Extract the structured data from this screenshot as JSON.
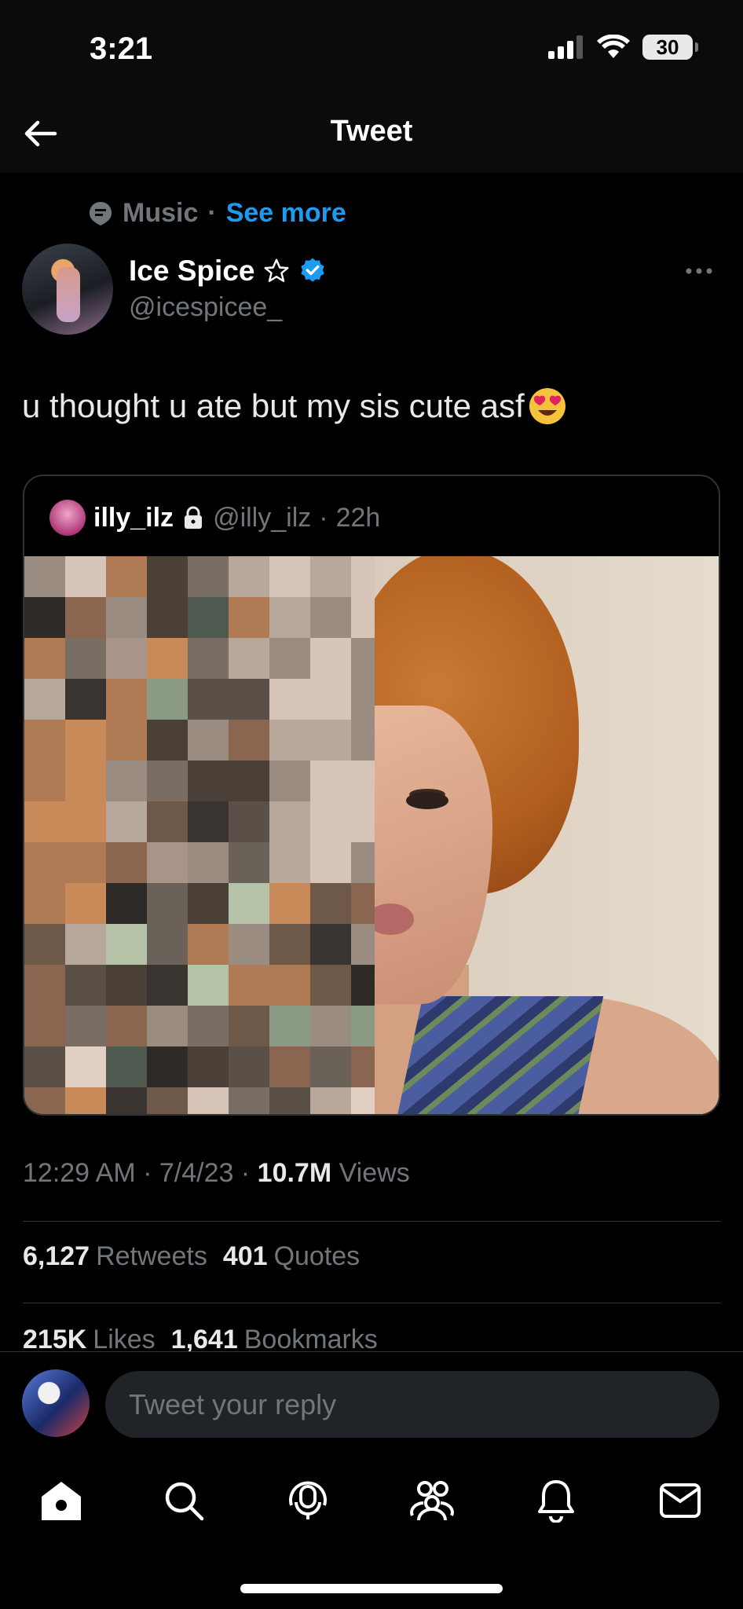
{
  "status_bar": {
    "time": "3:21",
    "battery": "30"
  },
  "nav": {
    "title": "Tweet"
  },
  "tweet": {
    "topic": "Music",
    "topic_sep": "·",
    "see_more": "See more",
    "author_name": "Ice Spice",
    "author_handle": "@icespicee_",
    "text": "u thought u ate but my sis cute asf",
    "quoted": {
      "name": "illy_ilz",
      "handle": "@illy_ilz",
      "sep": "·",
      "age": "22h"
    },
    "meta": {
      "time": "12:29 AM",
      "sep1": "·",
      "date": "7/4/23",
      "sep2": "·",
      "views_count": "10.7M",
      "views_label": "Views"
    },
    "stats": {
      "retweets_count": "6,127",
      "retweets_label": "Retweets",
      "quotes_count": "401",
      "quotes_label": "Quotes",
      "likes_count": "215K",
      "likes_label": "Likes",
      "bookmarks_count": "1,641",
      "bookmarks_label": "Bookmarks"
    }
  },
  "reply": {
    "placeholder": "Tweet your reply"
  },
  "tabs": [
    "home-icon",
    "search-icon",
    "spaces-icon",
    "communities-icon",
    "notifications-icon",
    "messages-icon"
  ],
  "colors": {
    "accent": "#1d9bf0",
    "muted": "#71767b",
    "text": "#e7e9ea",
    "divider": "#2f3336"
  }
}
